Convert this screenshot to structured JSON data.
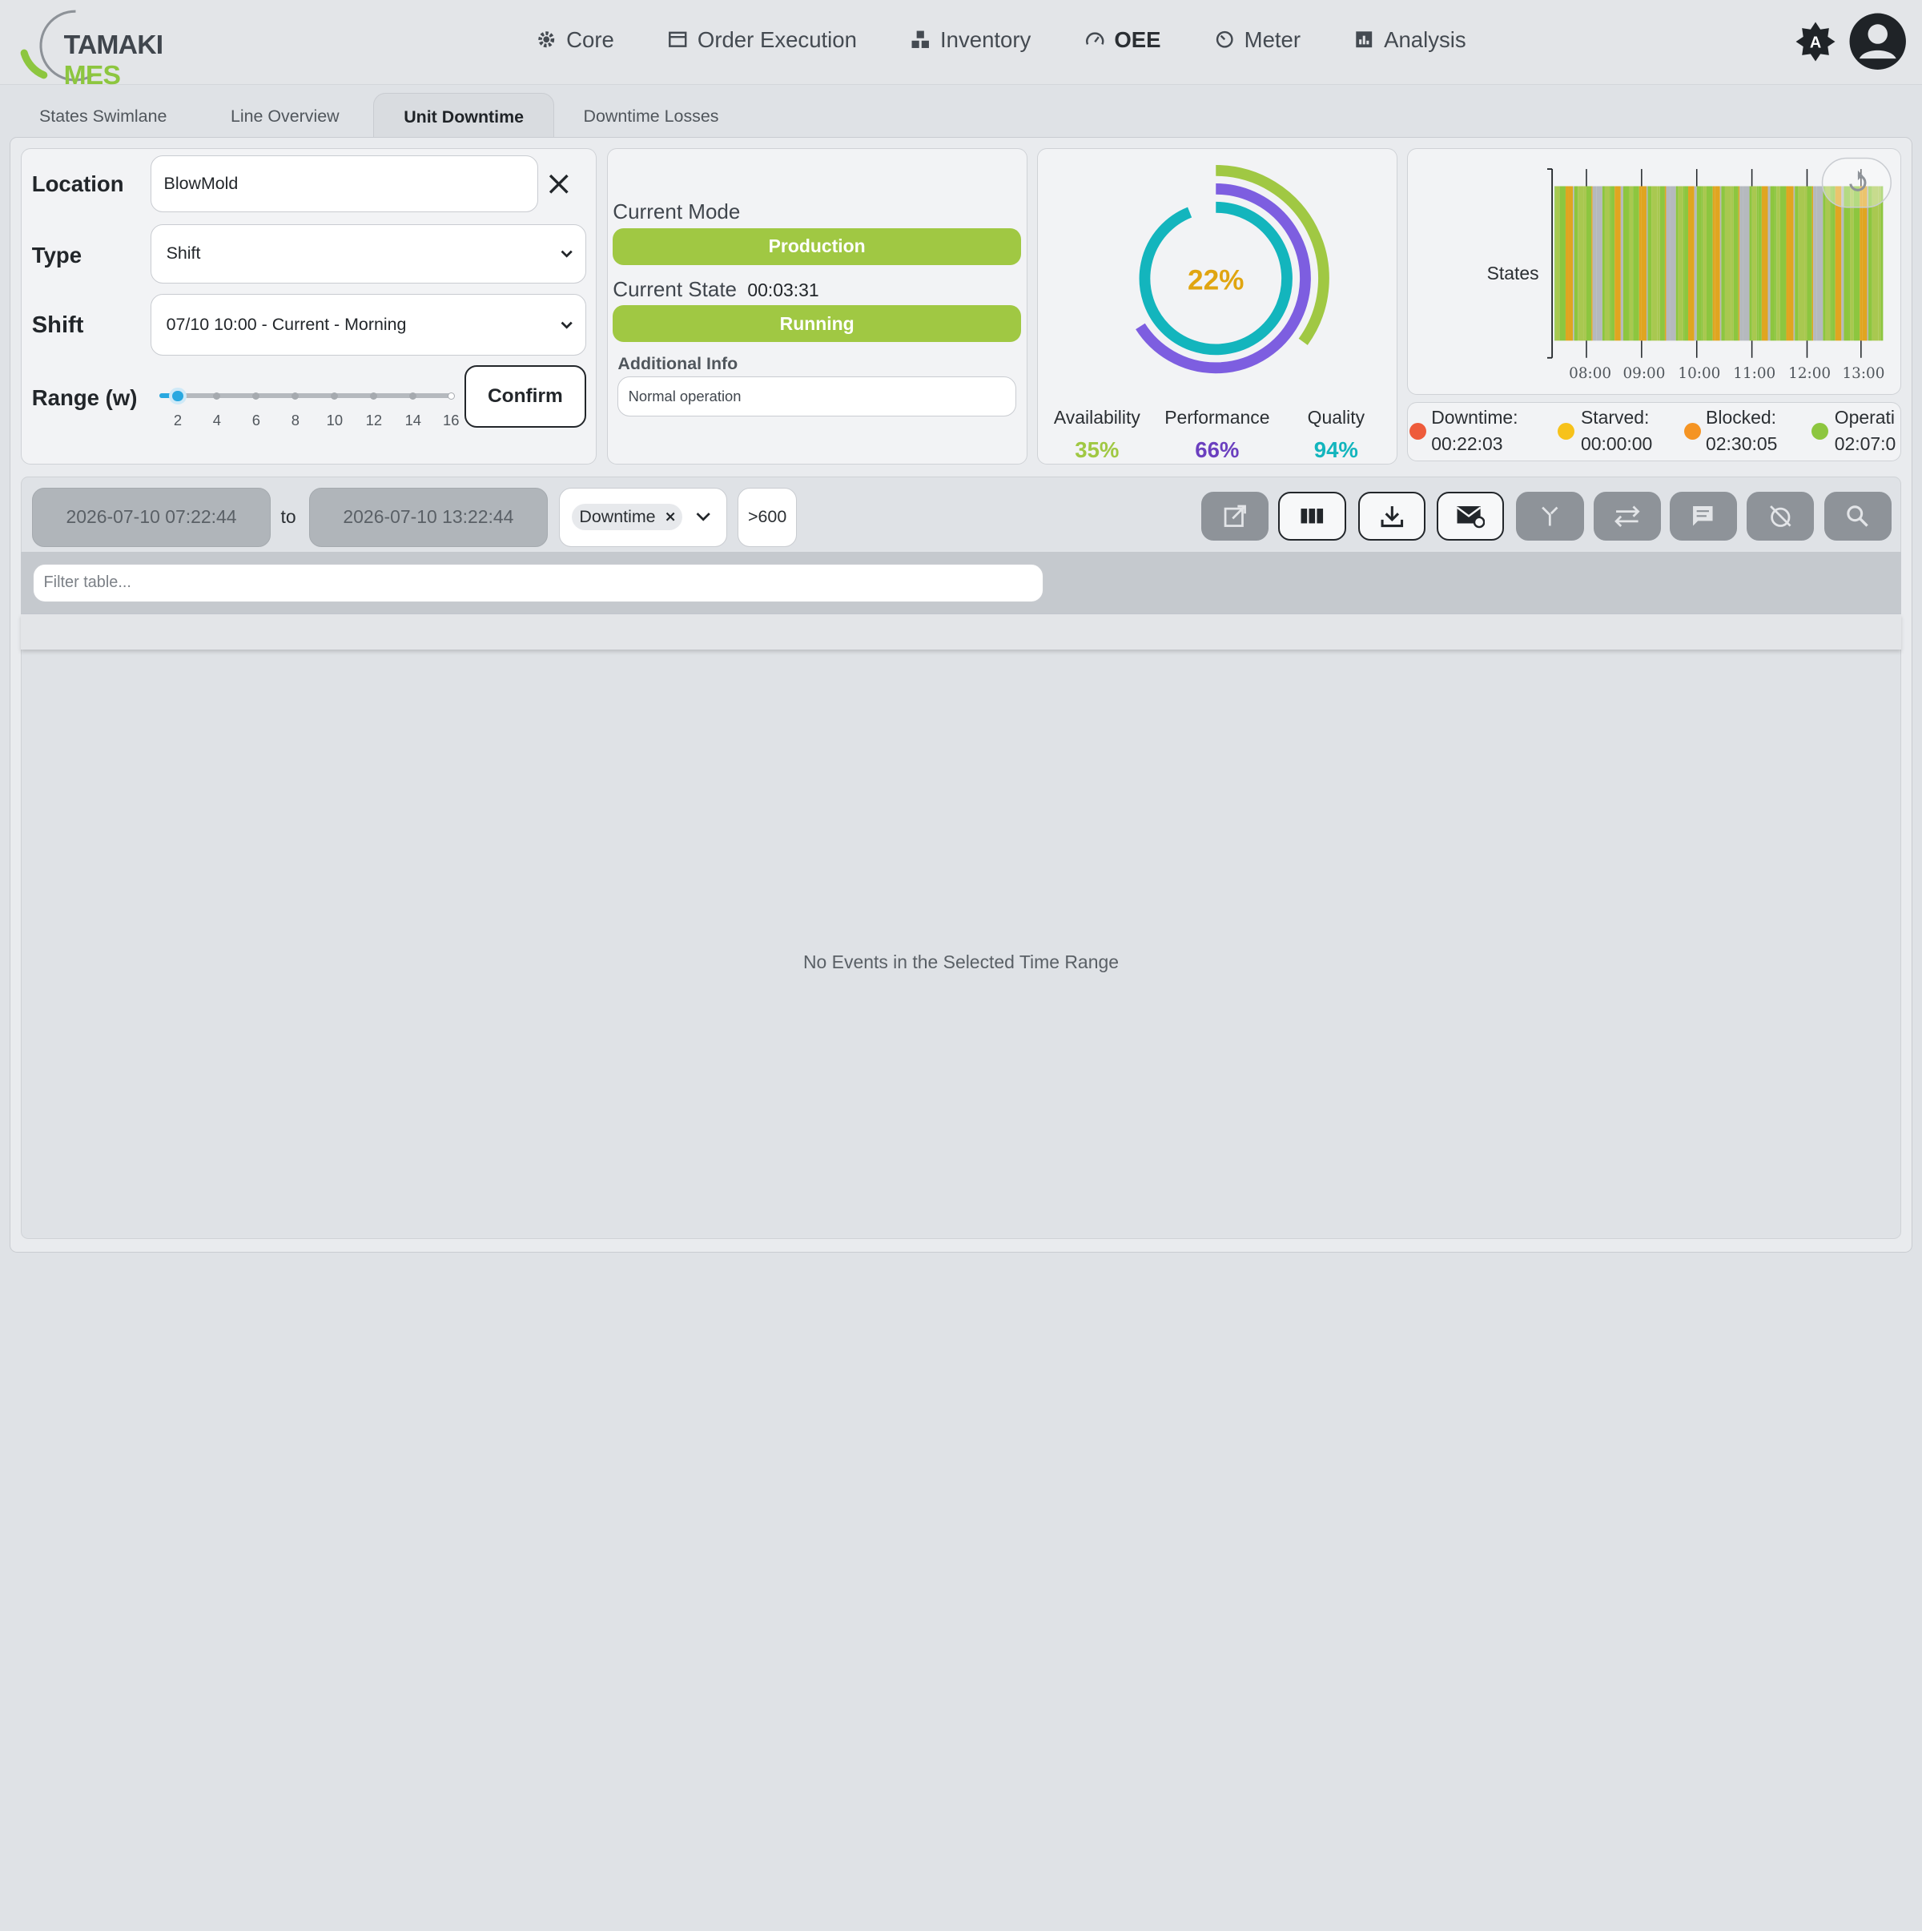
{
  "app": {
    "logo_text_a": "TAMAKI",
    "logo_text_b": "MES"
  },
  "nav": {
    "items": [
      {
        "label": "Core",
        "icon": "gear-icon"
      },
      {
        "label": "Order Execution",
        "icon": "calendar-icon"
      },
      {
        "label": "Inventory",
        "icon": "boxes-icon"
      },
      {
        "label": "OEE",
        "icon": "gauge-icon",
        "active": true
      },
      {
        "label": "Meter",
        "icon": "meter-icon"
      },
      {
        "label": "Analysis",
        "icon": "chart-icon"
      }
    ]
  },
  "tabs": [
    {
      "label": "States Swimlane"
    },
    {
      "label": "Line Overview"
    },
    {
      "label": "Unit Downtime",
      "active": true
    },
    {
      "label": "Downtime Losses"
    }
  ],
  "filters": {
    "location_label": "Location",
    "location_value": "BlowMold",
    "type_label": "Type",
    "type_value": "Shift",
    "shift_label": "Shift",
    "shift_value": "07/10 10:00 - Current - Morning",
    "range_label": "Range (w)",
    "range_value": 2,
    "range_ticks": [
      "2",
      "4",
      "6",
      "8",
      "10",
      "12",
      "14",
      "16"
    ],
    "confirm_label": "Confirm"
  },
  "mode": {
    "current_mode_label": "Current Mode",
    "current_mode_value": "Production",
    "current_state_label": "Current State",
    "current_state_duration": "00:03:31",
    "current_state_value": "Running",
    "additional_info_label": "Additional Info",
    "additional_info_value": "Normal operation"
  },
  "oee": {
    "value": "22%",
    "availability_label": "Availability",
    "availability_value": "35%",
    "performance_label": "Performance",
    "performance_value": "66%",
    "quality_label": "Quality",
    "quality_value": "94%",
    "colors": {
      "availability": "#a0c843",
      "performance": "#7d5ee0",
      "quality": "#13b5bd",
      "oee": "#e0a510"
    }
  },
  "states": {
    "title": "States",
    "times": [
      "08:00",
      "09:00",
      "10:00",
      "11:00",
      "12:00",
      "13:00"
    ]
  },
  "legend": [
    {
      "label": "Downtime:",
      "value": "00:22:03",
      "color": "#ee5b3b"
    },
    {
      "label": "Starved:",
      "value": "00:00:00",
      "color": "#f7c21a"
    },
    {
      "label": "Blocked:",
      "value": "02:30:05",
      "color": "#f59423"
    },
    {
      "label": "Operati",
      "value": "02:07:0",
      "color": "#8dc63f"
    }
  ],
  "toolbar": {
    "start_date": "2026-07-10 07:22:44",
    "to_label": "to",
    "end_date": "2026-07-10 13:22:44",
    "chip_label": "Downtime",
    "threshold": ">600"
  },
  "table": {
    "filter_placeholder": "Filter table...",
    "empty_message": "No Events in the Selected Time Range"
  }
}
